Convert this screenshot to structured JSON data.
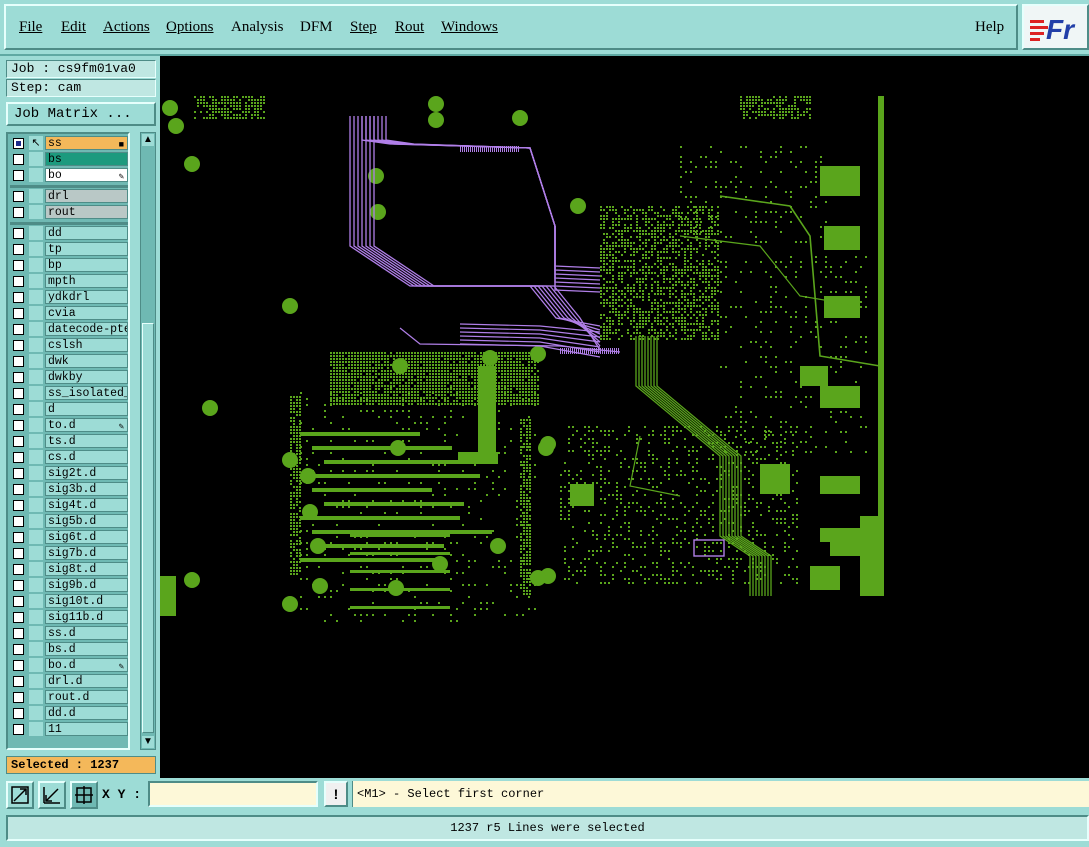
{
  "menu": {
    "items": [
      "File",
      "Edit",
      "Actions",
      "Options",
      "Analysis",
      "DFM",
      "Step",
      "Rout",
      "Windows"
    ],
    "help": "Help",
    "logo_text": "Fr"
  },
  "job": {
    "job_label": "Job : cs9fm01va0",
    "step_label": "Step: cam",
    "matrix_button": "Job Matrix ..."
  },
  "layers": {
    "group1": [
      {
        "name": "ss",
        "checked": true,
        "style": "sel-orange",
        "mark": "↖",
        "edit": "■"
      },
      {
        "name": "bs",
        "checked": false,
        "style": "sel-green",
        "mark": "",
        "edit": ""
      },
      {
        "name": "bo",
        "checked": false,
        "style": "white",
        "mark": "",
        "edit": "✎"
      }
    ],
    "group2": [
      {
        "name": "drl",
        "checked": false,
        "style": "grey",
        "mark": "",
        "edit": ""
      },
      {
        "name": "rout",
        "checked": false,
        "style": "grey",
        "mark": "",
        "edit": ""
      }
    ],
    "group3": [
      {
        "name": "dd",
        "edit": ""
      },
      {
        "name": "tp",
        "edit": ""
      },
      {
        "name": "bp",
        "edit": ""
      },
      {
        "name": "mpth",
        "edit": ""
      },
      {
        "name": "ydkdrl",
        "edit": ""
      },
      {
        "name": "cvia",
        "edit": ""
      },
      {
        "name": "datecode-pte",
        "edit": ""
      },
      {
        "name": "cslsh",
        "edit": ""
      },
      {
        "name": "dwk",
        "edit": ""
      },
      {
        "name": "dwkby",
        "edit": ""
      },
      {
        "name": "ss_isolated_",
        "edit": ""
      },
      {
        "name": "d",
        "edit": ""
      },
      {
        "name": "to.d",
        "edit": "✎"
      },
      {
        "name": "ts.d",
        "edit": ""
      },
      {
        "name": "cs.d",
        "edit": ""
      },
      {
        "name": "sig2t.d",
        "edit": ""
      },
      {
        "name": "sig3b.d",
        "edit": ""
      },
      {
        "name": "sig4t.d",
        "edit": ""
      },
      {
        "name": "sig5b.d",
        "edit": ""
      },
      {
        "name": "sig6t.d",
        "edit": ""
      },
      {
        "name": "sig7b.d",
        "edit": ""
      },
      {
        "name": "sig8t.d",
        "edit": ""
      },
      {
        "name": "sig9b.d",
        "edit": ""
      },
      {
        "name": "sig10t.d",
        "edit": ""
      },
      {
        "name": "sig11b.d",
        "edit": ""
      },
      {
        "name": "ss.d",
        "edit": ""
      },
      {
        "name": "bs.d",
        "edit": ""
      },
      {
        "name": "bo.d",
        "edit": "✎"
      },
      {
        "name": "drl.d",
        "edit": ""
      },
      {
        "name": "rout.d",
        "edit": ""
      },
      {
        "name": "dd.d",
        "edit": ""
      },
      {
        "name": "11",
        "edit": ""
      }
    ]
  },
  "selected_label": "Selected : 1237",
  "toolbar": {
    "xy_label": "X Y :",
    "xy_value": "",
    "pause_label": "!",
    "prompt": "<M1> - Select first corner"
  },
  "status": "1237 r5 Lines were selected",
  "colors": {
    "copper": "#5aa51c",
    "trace_selected": "#b07fe8",
    "canvas_bg": "#000000",
    "panel": "#9ddcd6"
  }
}
